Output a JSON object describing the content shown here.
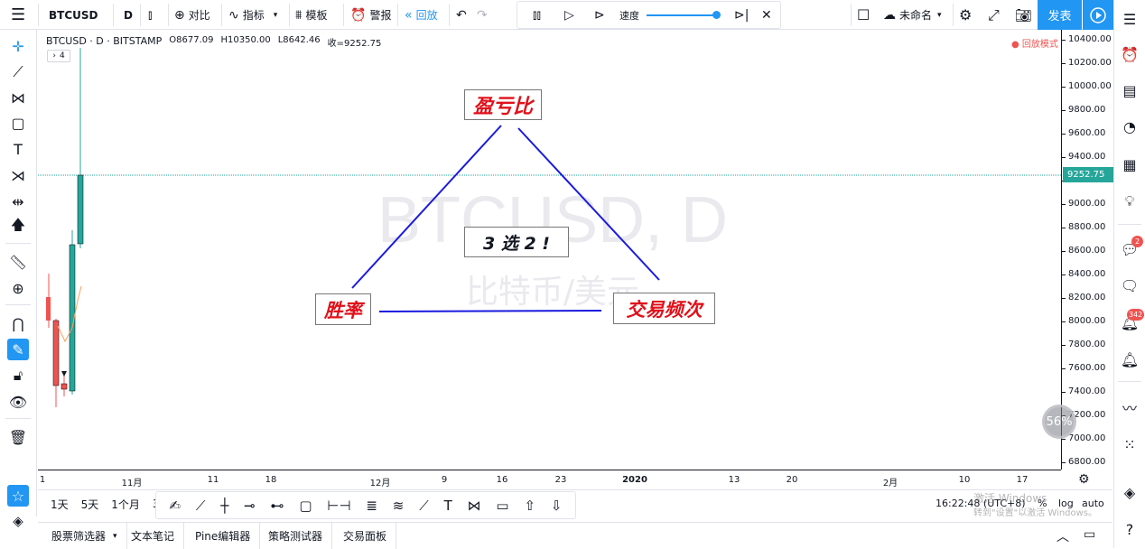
{
  "topbar": {
    "symbol": "BTCUSD",
    "interval": "D",
    "compare": "对比",
    "indicators": "指标",
    "templates": "模板",
    "alert": "警报",
    "replay": "回放",
    "speed_label": "速度",
    "layout_name": "未命名",
    "publish": "发表"
  },
  "legend": {
    "title": "BTCUSD · D · BITSTAMP",
    "open": "O8677.09",
    "high": "H10350.00",
    "low": "L8642.46",
    "close": "收=9252.75",
    "collapse": "4",
    "replay_mode": "● 回放模式"
  },
  "watermark": {
    "symbol": "BTCUSD, D",
    "desc": "比特币/美元"
  },
  "annotations": {
    "top": "盈亏比",
    "left": "胜率",
    "right": "交易频次",
    "center": "3 选 2 !"
  },
  "price_axis": {
    "labels": [
      "10400.00",
      "10200.00",
      "10000.00",
      "9800.00",
      "9600.00",
      "9400.00",
      "9200.00",
      "9000.00",
      "8800.00",
      "8600.00",
      "8400.00",
      "8200.00",
      "8000.00",
      "7800.00",
      "7600.00",
      "7400.00",
      "7200.00",
      "7000.00",
      "6800.00"
    ],
    "last_price": "9252.75",
    "percent_badge": "56%"
  },
  "time_axis": {
    "labels": [
      "1",
      "11月",
      "11",
      "18",
      "12月",
      "9",
      "16",
      "23",
      "2020",
      "13",
      "20",
      "2月",
      "10",
      "17"
    ]
  },
  "bottombar": {
    "ranges": [
      "1天",
      "5天",
      "1个月",
      "3"
    ],
    "clock": "16:22:48 (UTC+8)",
    "percent": "%",
    "log": "log",
    "auto": "auto",
    "win1": "激活 Windows",
    "win2": "转到\"设置\"以激活 Windows。"
  },
  "footer": {
    "tabs": [
      "股票筛选器",
      "文本笔记",
      "Pine编辑器",
      "策略测试器",
      "交易面板"
    ]
  },
  "badges": {
    "chat": "2",
    "notifications": "342"
  },
  "colors": {
    "up": "#26a69a",
    "down": "#ef5350",
    "accent": "#2196f3",
    "annot_text": "#e0101a",
    "lines": "#1a1adf"
  }
}
